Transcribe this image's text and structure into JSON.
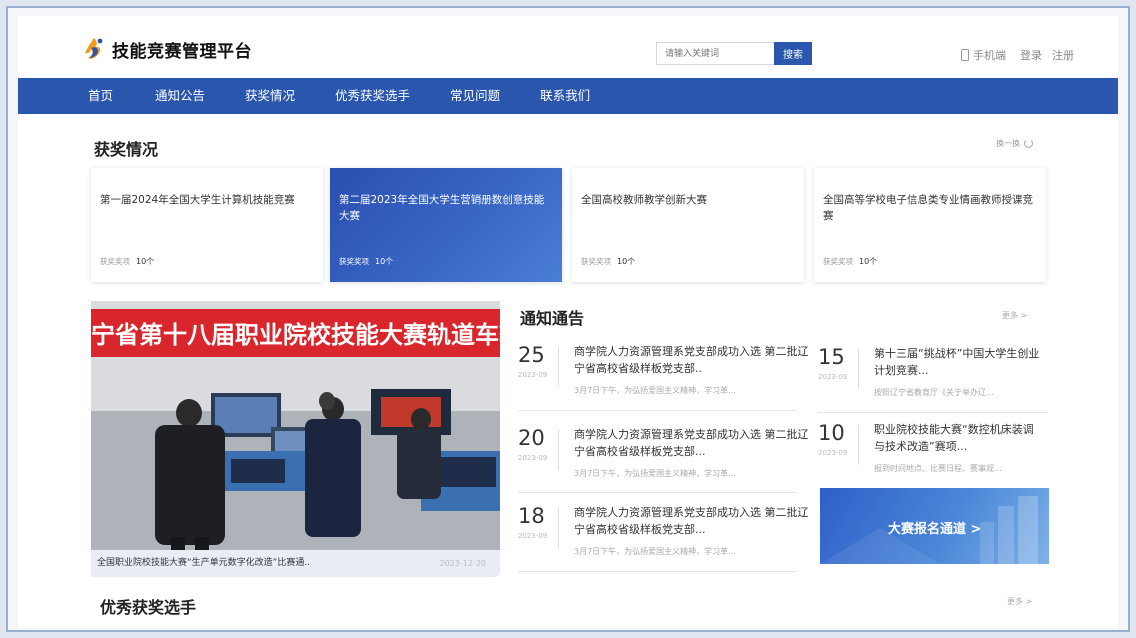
{
  "header": {
    "title": "技能竞赛管理平台",
    "search_placeholder": "请输入关键词",
    "search_button": "搜索",
    "mobile": "手机端",
    "login": "登录",
    "register": "注册"
  },
  "nav": [
    "首页",
    "通知公告",
    "获奖情况",
    "优秀获奖选手",
    "常见问题",
    "联系我们"
  ],
  "awards": {
    "title": "获奖情况",
    "swap": "换一换",
    "items": [
      {
        "name": "第一届2024年全国大学生计算机技能竞赛",
        "meta_label": "获奖奖项",
        "count": "10个"
      },
      {
        "name": "第二届2023年全国大学生营销册数创意技能大赛",
        "meta_label": "获奖奖项",
        "count": "10个"
      },
      {
        "name": "全国高校教师教学创新大赛",
        "meta_label": "获奖奖项",
        "count": "10个"
      },
      {
        "name": "全国高等学校电子信息类专业情画教师授课竞赛",
        "meta_label": "获奖奖项",
        "count": "10个"
      }
    ]
  },
  "photo": {
    "banner": "辽宁省第十八届职业院校技能大赛轨道车辆",
    "caption": "全国职业院校技能大赛“生产单元数字化改造”比赛通..",
    "date": "2023-12-20"
  },
  "notices": {
    "title": "通知通告",
    "more": "更多 >",
    "left": [
      {
        "day": "25",
        "ym": "2023-09",
        "title": "商学院人力资源管理系党支部成功入选 第二批辽宁省高校省级样板党支部..",
        "sub": "3月7日下午，为弘扬爱国主义精神，学习革..."
      },
      {
        "day": "20",
        "ym": "2023-09",
        "title": "商学院人力资源管理系党支部成功入选 第二批辽宁省高校省级样板党支部...",
        "sub": "3月7日下午，为弘扬爱国主义精神，学习革..."
      },
      {
        "day": "18",
        "ym": "2023-09",
        "title": "商学院人力资源管理系党支部成功入选 第二批辽宁省高校省级样板党支部...",
        "sub": "3月7日下午，为弘扬爱国主义精神，学习革..."
      }
    ],
    "right": [
      {
        "day": "15",
        "ym": "2023-09",
        "title": "第十三届“挑战杯”中国大学生创业 计划竞赛...",
        "sub": "按照辽宁省教育厅《关于举办辽..."
      },
      {
        "day": "10",
        "ym": "2023-09",
        "title": "职业院校技能大赛“数控机床装调与技术改造”赛项...",
        "sub": "报到时间地点、比赛日程、赛事观..."
      }
    ],
    "signup": "大赛报名通道 >"
  },
  "players": {
    "title": "优秀获奖选手",
    "more": "更多 >"
  },
  "colors": {
    "primary": "#2a56ad",
    "banner_red": "#d8262c"
  }
}
